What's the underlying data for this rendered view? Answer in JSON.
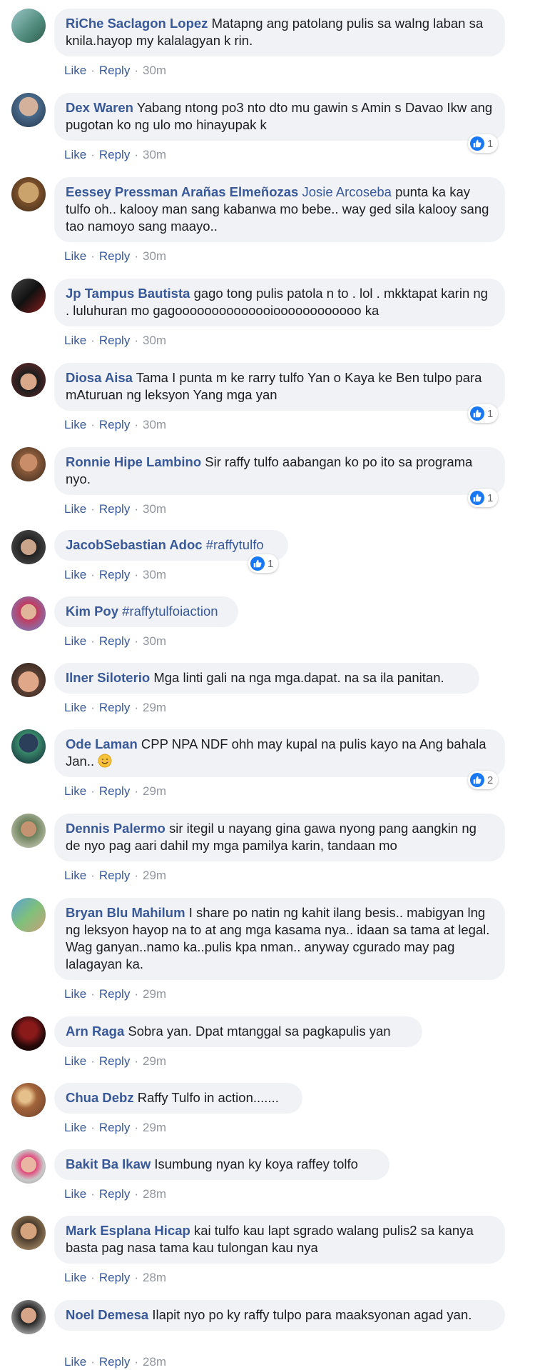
{
  "actions": {
    "like": "Like",
    "reply": "Reply",
    "separator": "·"
  },
  "comments": [
    {
      "author": "RiChe Saclagon Lopez",
      "text": "Matapng ang patolang pulis sa walng laban sa knila.hayop my kalalagyan k rin.",
      "time": "30m",
      "reactions": ""
    },
    {
      "author": "Dex Waren",
      "text": "Yabang ntong po3 nto dto mu gawin s Amin s Davao Ikw ang pugotan ko ng ulo mo hinayupak k",
      "time": "30m",
      "reactions": "1"
    },
    {
      "author": "Eessey Pressman Arañas Elmeñozas",
      "mention": "Josie Arcoseba",
      "text": "punta ka kay tulfo oh.. kalooy man sang kabanwa mo bebe.. way ged sila kalooy sang tao namoyo sang maayo..",
      "time": "30m",
      "reactions": ""
    },
    {
      "author": "Jp Tampus Bautista",
      "text": "gago tong pulis patola n to . lol . mkktapat karin ng . luluhuran mo gagoooooooooooooioooooooooooo ka",
      "time": "30m",
      "reactions": ""
    },
    {
      "author": "Diosa Aisa",
      "text": "Tama I punta m ke rarry tulfo Yan o Kaya ke Ben tulpo para mAturuan ng leksyon Yang mga yan",
      "time": "30m",
      "reactions": "1"
    },
    {
      "author": "Ronnie Hipe Lambino",
      "text": "Sir raffy tulfo aabangan ko po ito sa programa nyo.",
      "time": "30m",
      "reactions": "1"
    },
    {
      "author": "JacobSebastian Adoc",
      "mention": "#raffytulfo",
      "text": "",
      "time": "30m",
      "reactions": "1"
    },
    {
      "author": "Kim Poy",
      "mention": "#raffytulfoiaction",
      "text": "",
      "time": "30m",
      "reactions": ""
    },
    {
      "author": "Ilner Siloterio",
      "text": "Mga linti gali na nga mga.dapat. na sa ila panitan.",
      "time": "29m",
      "reactions": ""
    },
    {
      "author": "Ode Laman",
      "text": "CPP NPA NDF ohh may kupal na pulis kayo na Ang bahala Jan..",
      "time": "29m",
      "reactions": "2"
    },
    {
      "author": "Dennis Palermo",
      "text": "sir itegil u nayang gina gawa nyong pang aangkin ng de nyo pag aari dahil my mga pamilya karin, tandaan mo",
      "time": "29m",
      "reactions": ""
    },
    {
      "author": "Bryan Blu Mahilum",
      "text": "I share po natin ng kahit ilang besis.. mabigyan lng ng leksyon hayop na to at ang mga kasama nya.. idaan sa tama at legal. Wag ganyan..namo ka..pulis kpa nman.. anyway cgurado may pag lalagayan ka.",
      "time": "29m",
      "reactions": ""
    },
    {
      "author": "Arn Raga",
      "text": "Sobra yan. Dpat mtanggal sa pagkapulis yan",
      "time": "29m",
      "reactions": ""
    },
    {
      "author": "Chua Debz",
      "text": "Raffy Tulfo in action.......",
      "time": "29m",
      "reactions": ""
    },
    {
      "author": "Bakit Ba Ikaw",
      "text": "Isumbung nyan ky koya raffey tolfo",
      "time": "28m",
      "reactions": ""
    },
    {
      "author": "Mark Esplana Hicap",
      "text": "kai tulfo kau lapt sgrado walang pulis2 sa kanya basta pag nasa tama kau tulongan kau nya",
      "time": "28m",
      "reactions": ""
    },
    {
      "author": "Noel Demesa",
      "text": "Ilapit nyo po ky raffy tulpo para maaksyonan agad yan.",
      "time": "28m",
      "reactions": ""
    }
  ],
  "colors": {
    "link": "#385898",
    "bubble": "#f0f2f5",
    "muted": "#90949c",
    "like_blue": "#1877f2"
  }
}
